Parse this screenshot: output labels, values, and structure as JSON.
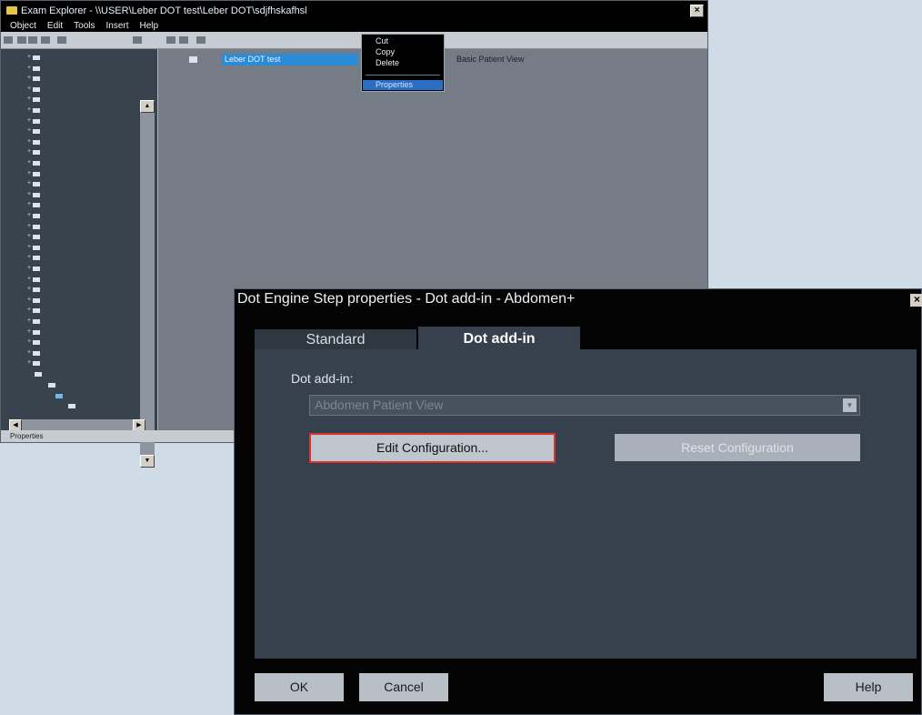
{
  "explorer": {
    "title": "Exam Explorer - \\\\USER\\Leber DOT test\\Leber DOT\\sdjfhskafhsl",
    "close_label": "×",
    "menu": [
      "Object",
      "Edit",
      "Tools",
      "Insert",
      "Help"
    ],
    "list_row": {
      "name": "Leber DOT test",
      "view": "Basic Patient View"
    },
    "context_menu": {
      "cut": "Cut",
      "copy": "Copy",
      "delete": "Delete",
      "properties": "Properties"
    },
    "status": "Properties"
  },
  "dialog": {
    "title": "Dot Engine Step properties - Dot add-in - Abdomen+",
    "close_label": "×",
    "tabs": {
      "standard": "Standard",
      "dot_addin": "Dot add-in"
    },
    "dot_addin_label": "Dot add-in:",
    "dot_addin_value": "Abdomen Patient View",
    "edit_config": "Edit Configuration...",
    "reset_config": "Reset Configuration",
    "ok": "OK",
    "cancel": "Cancel",
    "help": "Help"
  },
  "colors": {
    "highlight_border": "#d8342c",
    "selection_blue": "#2b8bd6"
  }
}
